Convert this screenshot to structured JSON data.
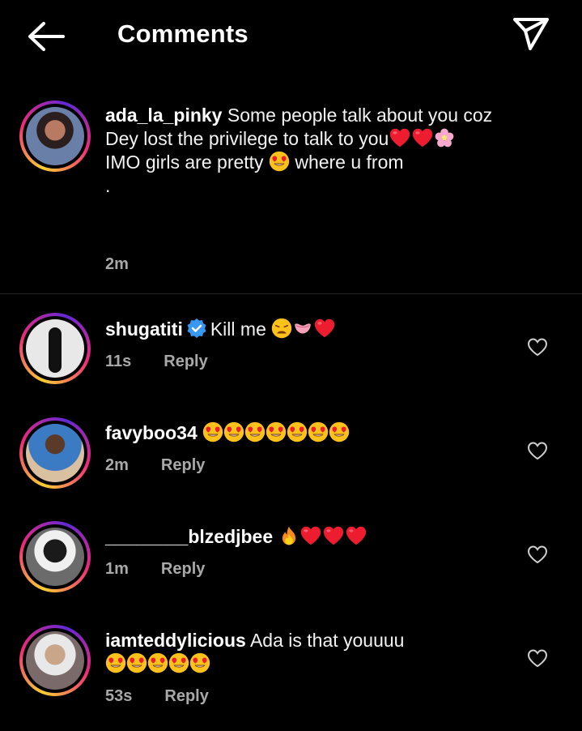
{
  "header": {
    "title": "Comments",
    "back_icon": "arrow-left-icon",
    "share_icon": "paper-plane-icon"
  },
  "caption": {
    "username": "ada_la_pinky",
    "text_line1": "Some people talk about you coz",
    "text_line2": "Dey lost the privilege to talk to you",
    "text_line3": "IMO girls are pretty",
    "text_line3b": "where u from",
    "text_line4": ".",
    "time": "2m"
  },
  "comments": [
    {
      "username": "shugatiti",
      "text": "Kill me",
      "time": "11s",
      "reply": "Reply",
      "verified": true
    },
    {
      "username": "favyboo34",
      "text": "",
      "time": "2m",
      "reply": "Reply"
    },
    {
      "username": "________blzedjbee",
      "text": "",
      "time": "1m",
      "reply": "Reply"
    },
    {
      "username": "iamteddylicious",
      "text": "Ada is that youuuu",
      "time": "53s",
      "reply": "Reply"
    }
  ],
  "colors": {
    "background": "#000000",
    "meta_text": "#a8a8a8",
    "verified": "#3897f0",
    "heart": "#ed1d2f",
    "divider": "#262626"
  }
}
